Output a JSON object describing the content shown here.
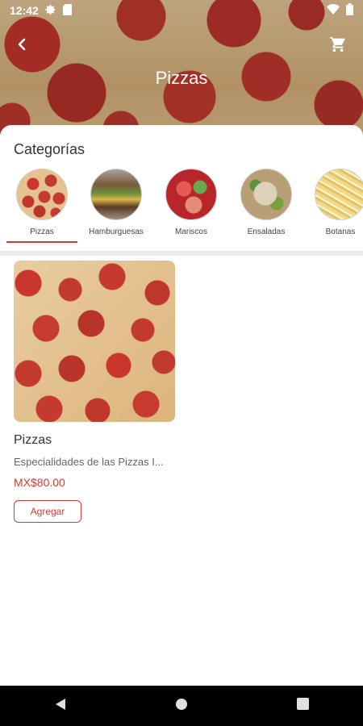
{
  "status_bar": {
    "time": "12:42",
    "icons": [
      "gear-icon",
      "sd-card-icon",
      "wifi-icon",
      "battery-icon"
    ]
  },
  "header": {
    "title": "Pizzas",
    "back_icon": "chevron-left-icon",
    "cart_icon": "cart-icon"
  },
  "categories": {
    "title": "Categorías",
    "items": [
      {
        "label": "Pizzas",
        "thumb": "pizza",
        "selected": true
      },
      {
        "label": "Hamburguesas",
        "thumb": "burger",
        "selected": false
      },
      {
        "label": "Mariscos",
        "thumb": "mariscos",
        "selected": false
      },
      {
        "label": "Ensaladas",
        "thumb": "ensaladas",
        "selected": false
      },
      {
        "label": "Botanas",
        "thumb": "botanas",
        "selected": false
      }
    ]
  },
  "products": [
    {
      "name": "Pizzas",
      "description": "Especialidades de las Pizzas  I...",
      "price": "MX$80.00",
      "add_label": "Agregar"
    }
  ],
  "colors": {
    "accent": "#d23b35",
    "nav": "#000000"
  },
  "nav_bar": {
    "icons": [
      "back-triangle-icon",
      "home-circle-icon",
      "recents-square-icon"
    ]
  }
}
